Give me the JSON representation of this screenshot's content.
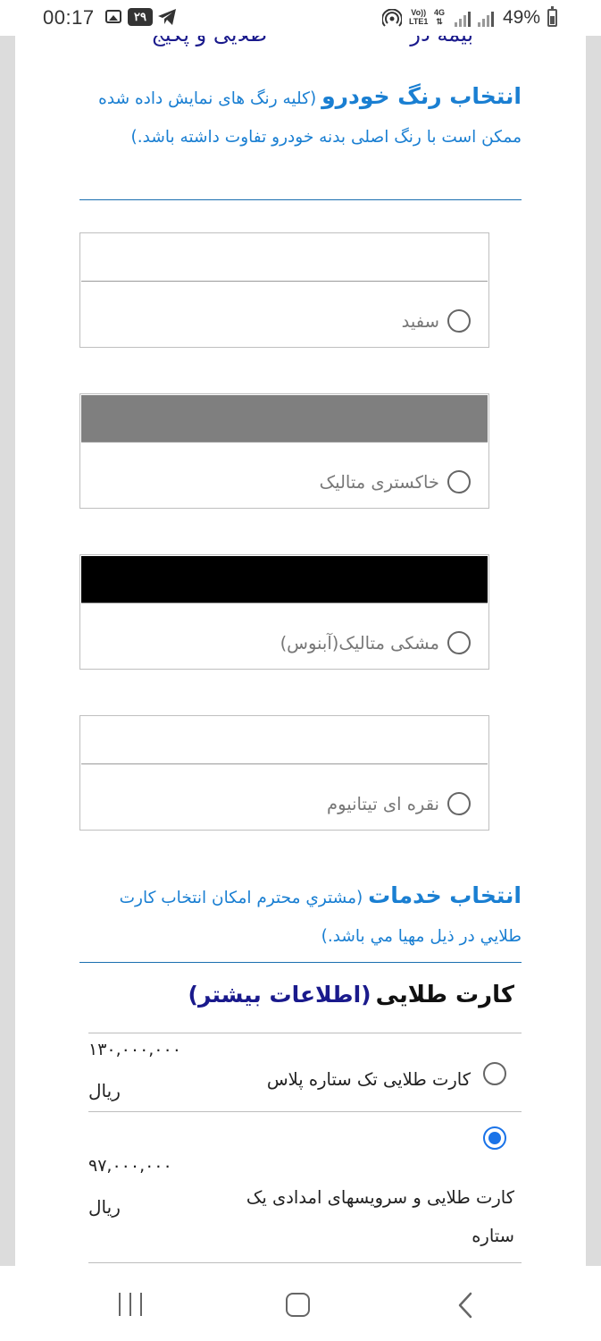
{
  "status_bar": {
    "time": "00:17",
    "notification_badge": "۲۹",
    "volte_label_line1": "Vo))",
    "volte_label_line2": "LTE1",
    "network_label": "4G",
    "battery_percent": "49%",
    "icons": [
      "gallery-icon",
      "telegram-icon",
      "hotspot-icon",
      "signal-icon",
      "battery-icon"
    ]
  },
  "page": {
    "top_cut_text_right": "بیمه در",
    "top_cut_text_left": "طلایی و پکیج",
    "color_section": {
      "title": "انتخاب رنگ خودرو",
      "note": "(کلیه رنگ های نمایش داده شده ممکن است با رنگ اصلی بدنه خودرو تفاوت داشته باشد.)"
    },
    "colors": [
      {
        "label": "سفید",
        "swatch": "#ffffff",
        "selected": false
      },
      {
        "label": "خاکستری متالیک",
        "swatch": "#7f7f7f",
        "selected": false
      },
      {
        "label": "مشکی متالیک(آبنوس)",
        "swatch": "#000000",
        "selected": false
      },
      {
        "label": "نقره ای تیتانیوم",
        "swatch": "#ffffff",
        "selected": false
      }
    ],
    "services_section": {
      "title": "انتخاب خدمات",
      "note": "(مشتري محترم امكان انتخاب كارت طلايي در ذيل مهيا مي باشد.)"
    },
    "golden_card": {
      "title": "کارت طلایی",
      "more_info": "(اطلاعات بیشتر)",
      "options": [
        {
          "label": "کارت طلایی تک ستاره پلاس",
          "price": "۱۳۰,۰۰۰,۰۰۰",
          "currency": "ریال",
          "selected": false
        },
        {
          "label": "کارت طلایی و سرویسهای امدادی یک ستاره",
          "price": "۹۷,۰۰۰,۰۰۰",
          "currency": "ریال",
          "selected": true
        }
      ]
    }
  },
  "colors": {
    "accent_blue": "#1a7fd2",
    "link_dark_blue": "#1a1a8c",
    "radio_selected": "#1a73e8"
  },
  "nav_bar": {
    "buttons": [
      "recent-apps-button",
      "home-button",
      "back-button"
    ]
  }
}
